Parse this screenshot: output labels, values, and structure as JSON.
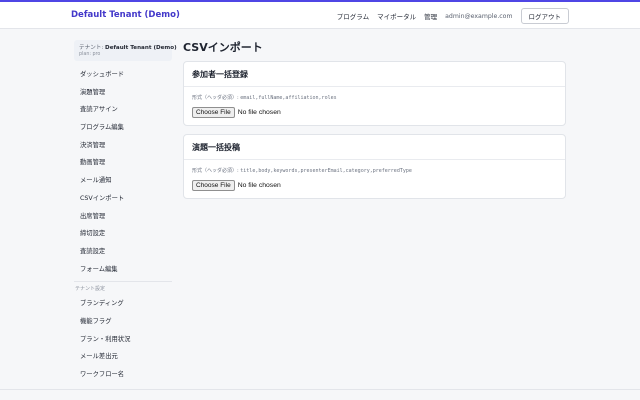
{
  "header": {
    "brand": "Default Tenant (Demo)",
    "nav": [
      "プログラム",
      "マイポータル",
      "管理"
    ],
    "email": "admin@example.com",
    "logout_label": "ログアウト",
    "accent_color": "#4f46e5"
  },
  "sidebar": {
    "tenant_prefix": "テナント: ",
    "tenant_name": "Default Tenant (Demo)",
    "plan": "plan: pro",
    "items": [
      {
        "label": "ダッシュボード"
      },
      {
        "label": "演題管理"
      },
      {
        "label": "査読アサイン"
      },
      {
        "label": "プログラム編集"
      },
      {
        "label": "決済管理"
      },
      {
        "label": "動画管理"
      },
      {
        "label": "メール通知"
      },
      {
        "label": "CSVインポート"
      },
      {
        "label": "出席管理"
      },
      {
        "label": "締切設定"
      },
      {
        "label": "査読設定"
      },
      {
        "label": "フォーム編集"
      }
    ],
    "section_label": "テナント設定",
    "settings_items": [
      {
        "label": "ブランディング"
      },
      {
        "label": "機能フラグ"
      },
      {
        "label": "プラン・利用状況"
      },
      {
        "label": "メール差出元"
      },
      {
        "label": "ワークフロー名"
      }
    ]
  },
  "main": {
    "title": "CSVインポート",
    "cards": [
      {
        "title": "参加者一括登録",
        "format_label": "形式（ヘッダ必須）: ",
        "format_cols": "email,fullName,affiliation,roles",
        "file_button": "Choose File",
        "file_status": "No file chosen"
      },
      {
        "title": "演題一括投稿",
        "format_label": "形式（ヘッダ必須）: ",
        "format_cols": "title,body,keywords,presenterEmail,category,preferredType",
        "file_button": "Choose File",
        "file_status": "No file chosen"
      }
    ]
  }
}
